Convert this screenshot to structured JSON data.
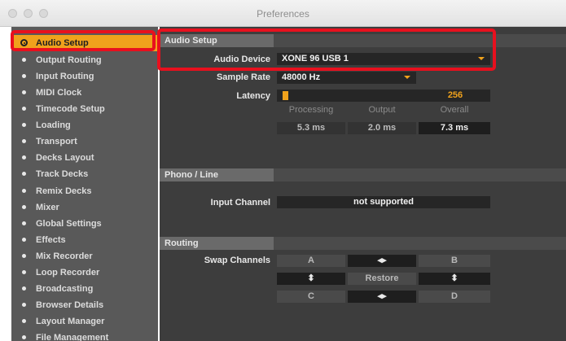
{
  "window": {
    "title": "Preferences"
  },
  "sidebar": {
    "items": [
      {
        "label": "Audio Setup",
        "active": true
      },
      {
        "label": "Output Routing"
      },
      {
        "label": "Input Routing"
      },
      {
        "label": "MIDI Clock"
      },
      {
        "label": "Timecode Setup"
      },
      {
        "label": "Loading"
      },
      {
        "label": "Transport"
      },
      {
        "label": "Decks Layout"
      },
      {
        "label": "Track Decks"
      },
      {
        "label": "Remix Decks"
      },
      {
        "label": "Mixer"
      },
      {
        "label": "Global Settings"
      },
      {
        "label": "Effects"
      },
      {
        "label": "Mix Recorder"
      },
      {
        "label": "Loop Recorder"
      },
      {
        "label": "Broadcasting"
      },
      {
        "label": "Browser Details"
      },
      {
        "label": "Layout Manager"
      },
      {
        "label": "File Management"
      }
    ]
  },
  "audio_setup": {
    "title": "Audio Setup",
    "audio_device_label": "Audio Device",
    "audio_device_value": "XONE 96 USB 1",
    "sample_rate_label": "Sample Rate",
    "sample_rate_value": "48000 Hz",
    "latency_label": "Latency",
    "latency_value": "256",
    "latency_fraction": 0.03,
    "processing_label": "Processing",
    "output_label": "Output",
    "overall_label": "Overall",
    "processing_value": "5.3 ms",
    "output_value": "2.0 ms",
    "overall_value": "7.3 ms"
  },
  "phono_line": {
    "title": "Phono / Line",
    "input_channel_label": "Input Channel",
    "input_channel_value": "not supported"
  },
  "routing": {
    "title": "Routing",
    "swap_channels_label": "Swap Channels",
    "a_label": "A",
    "b_label": "B",
    "c_label": "C",
    "d_label": "D",
    "swap_lr_icon": "◂▸",
    "swap_ud_icon": "⬍",
    "restore_label": "Restore"
  },
  "colors": {
    "accent": "#f0a21c",
    "highlight": "#e8101e",
    "panel": "#3d3d3d",
    "sidebar": "#595959"
  }
}
